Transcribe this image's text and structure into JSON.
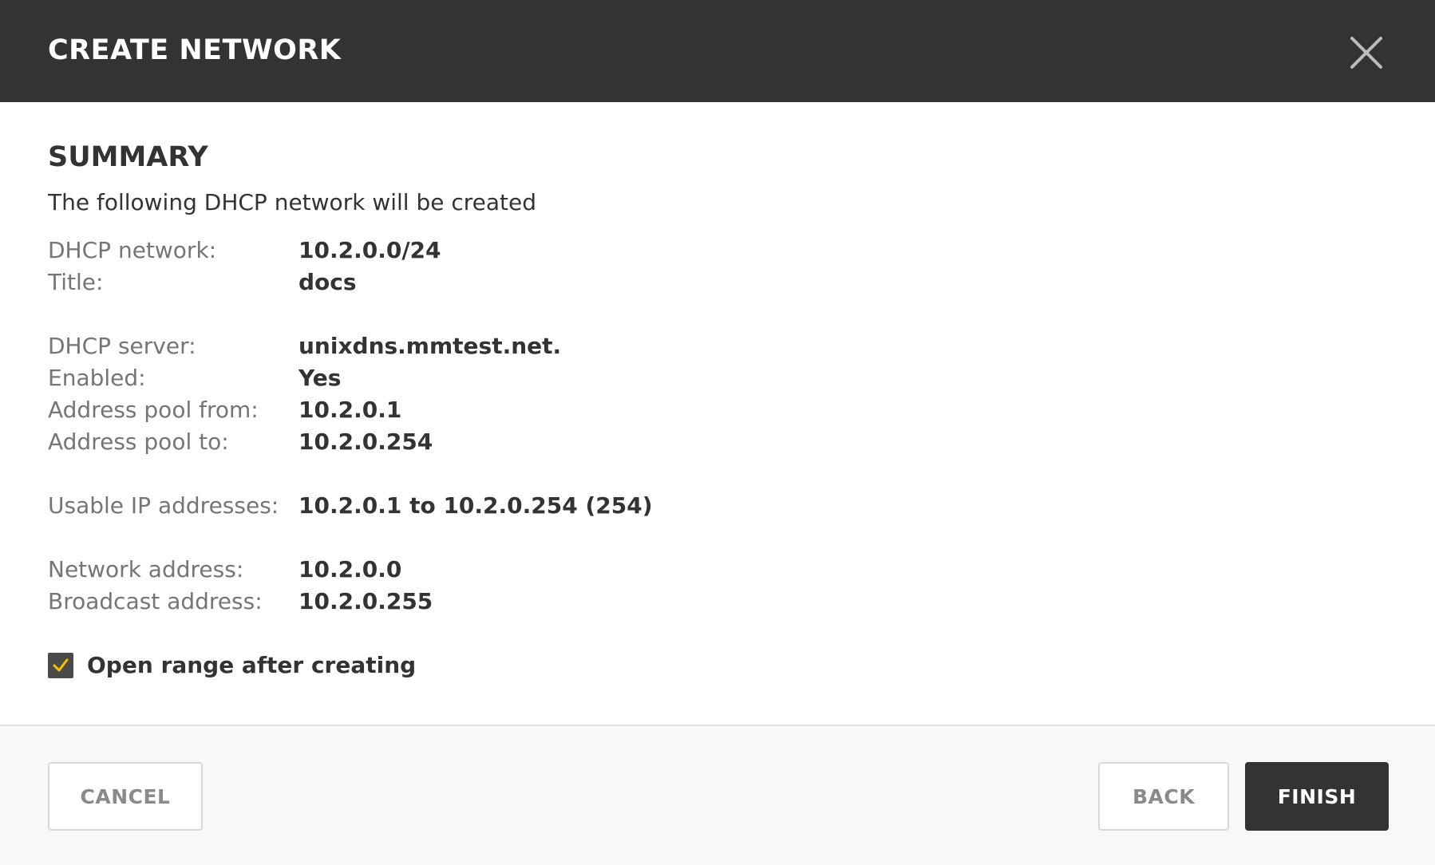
{
  "dialog": {
    "title": "CREATE NETWORK",
    "close_icon": "close-icon"
  },
  "summary": {
    "heading": "SUMMARY",
    "intro": "The following DHCP network will be created",
    "rows": [
      {
        "label": "DHCP network:",
        "value": "10.2.0.0/24"
      },
      {
        "label": "Title:",
        "value": "docs"
      },
      {
        "label": "DHCP server:",
        "value": "unixdns.mmtest.net."
      },
      {
        "label": "Enabled:",
        "value": "Yes"
      },
      {
        "label": "Address pool from:",
        "value": "10.2.0.1"
      },
      {
        "label": "Address pool to:",
        "value": "10.2.0.254"
      },
      {
        "label": "Usable IP addresses:",
        "value": "10.2.0.1 to 10.2.0.254 (254)"
      },
      {
        "label": "Network address:",
        "value": "10.2.0.0"
      },
      {
        "label": "Broadcast address:",
        "value": "10.2.0.255"
      }
    ],
    "open_range": {
      "label": "Open range after creating",
      "checked": true,
      "check_color": "#f5c400"
    }
  },
  "footer": {
    "cancel_label": "CANCEL",
    "back_label": "BACK",
    "finish_label": "FINISH"
  },
  "colors": {
    "header_bg": "#333333",
    "primary_button": "#333333",
    "checkbox_bg": "#4a4a4a",
    "checkmark": "#f5c400"
  }
}
